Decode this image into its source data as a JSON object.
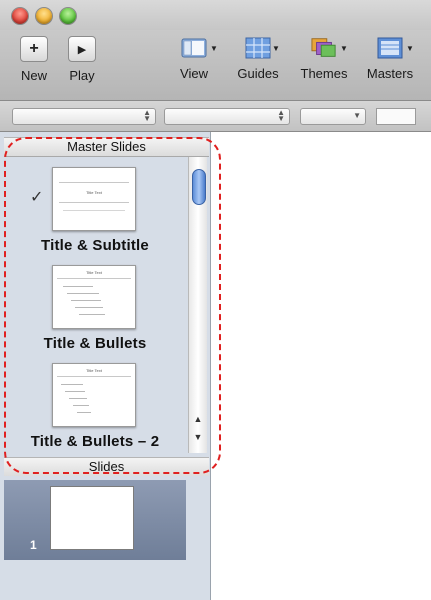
{
  "window": {
    "traffic_lights": [
      "close",
      "minimize",
      "zoom"
    ]
  },
  "toolbar": {
    "new_label": "New",
    "play_label": "Play",
    "view_label": "View",
    "guides_label": "Guides",
    "themes_label": "Themes",
    "masters_label": "Masters"
  },
  "panel": {
    "master_header": "Master Slides",
    "slides_header": "Slides",
    "masters": [
      {
        "label": "Title & Subtitle",
        "thumb_title": "Title Text",
        "selected": true
      },
      {
        "label": "Title & Bullets",
        "thumb_title": "Title Text",
        "selected": false
      },
      {
        "label": "Title & Bullets – 2",
        "thumb_title": "Title Text",
        "selected": false
      }
    ],
    "slides": [
      {
        "number": "1"
      }
    ]
  },
  "colors": {
    "highlight": "#e02020",
    "panel_bg": "#d6dde7",
    "selection": "#7b8aa4"
  }
}
